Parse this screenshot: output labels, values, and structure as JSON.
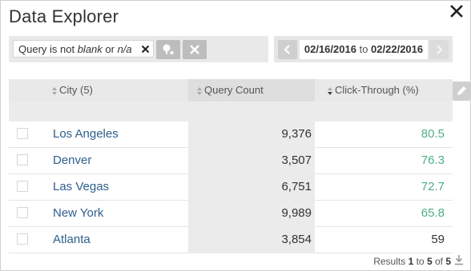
{
  "window": {
    "title": "Data Explorer"
  },
  "filter": {
    "prefix": "Query is not ",
    "value1": "blank",
    "conj": " or ",
    "value2": "n/a"
  },
  "date_range": {
    "start": "02/16/2016",
    "sep": "to",
    "end": "02/22/2016"
  },
  "table": {
    "columns": [
      "City (5)",
      "Query Count",
      "Click-Through (%)"
    ],
    "rows": [
      {
        "city": "Los Angeles",
        "query_count": "9,376",
        "ctr": "80.5",
        "ctr_color": "#4caf82"
      },
      {
        "city": "Denver",
        "query_count": "3,507",
        "ctr": "76.3",
        "ctr_color": "#4caf82"
      },
      {
        "city": "Las Vegas",
        "query_count": "6,751",
        "ctr": "72.7",
        "ctr_color": "#4caf82"
      },
      {
        "city": "New York",
        "query_count": "9,989",
        "ctr": "65.8",
        "ctr_color": "#4caf82"
      },
      {
        "city": "Atlanta",
        "query_count": "3,854",
        "ctr": "59",
        "ctr_color": "#333333"
      }
    ]
  },
  "footer": {
    "prefix": "Results ",
    "from": "1",
    "to_word": " to ",
    "to": "5",
    "of_word": " of ",
    "total": "5"
  },
  "colors": {
    "link": "#2d5f8e",
    "good": "#4caf82"
  }
}
